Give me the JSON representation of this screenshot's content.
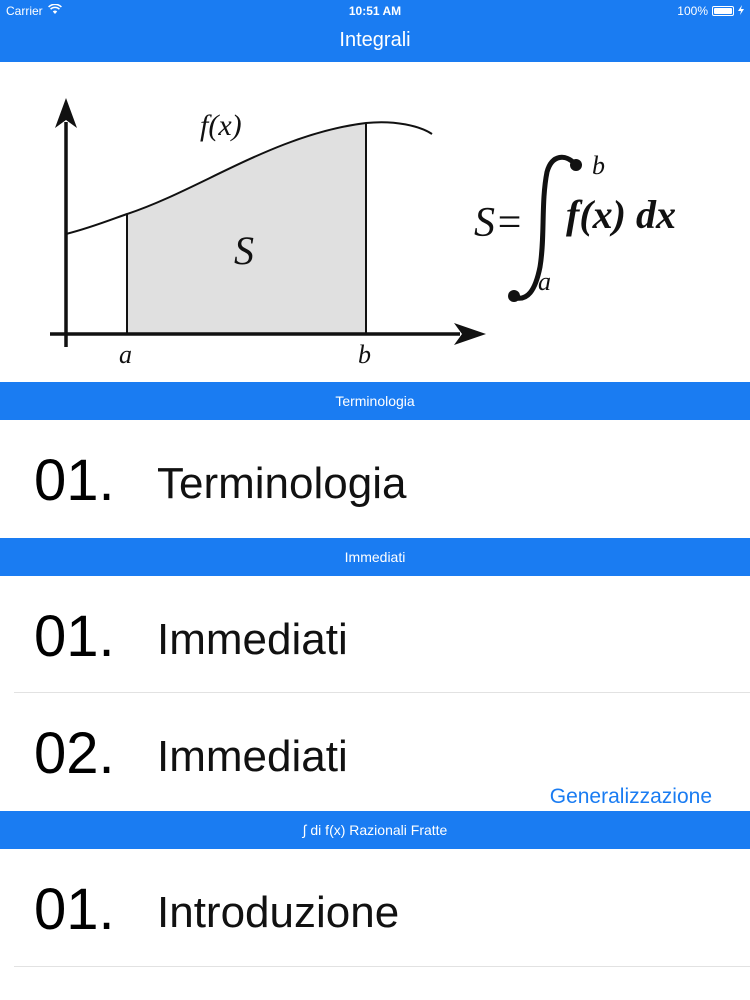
{
  "status_bar": {
    "carrier": "Carrier",
    "time": "10:51 AM",
    "battery": "100%",
    "battery_level": 1.0,
    "icons": [
      "wifi-icon",
      "battery-icon",
      "charging-icon"
    ]
  },
  "nav": {
    "title": "Integrali"
  },
  "hero": {
    "function_label": "f(x)",
    "area_label": "S",
    "lower_bound": "a",
    "upper_bound": "b",
    "formula": {
      "lhs": "S=",
      "integrand": "f(x) dx"
    }
  },
  "sections": [
    {
      "header": "Terminologia",
      "rows": [
        {
          "number": "01.",
          "title": "Terminologia",
          "subtitle": ""
        }
      ]
    },
    {
      "header": "Immediati",
      "rows": [
        {
          "number": "01.",
          "title": "Immediati",
          "subtitle": ""
        },
        {
          "number": "02.",
          "title": "Immediati",
          "subtitle": "Generalizzazione"
        }
      ]
    },
    {
      "header": "∫ di f(x) Razionali Fratte",
      "rows": [
        {
          "number": "01.",
          "title": "Introduzione",
          "subtitle": ""
        }
      ]
    }
  ],
  "colors": {
    "accent": "#1a7cf2",
    "background": "#ffffff",
    "text": "#000000",
    "separator": "#e2e2e2",
    "area_fill": "#e0e0e0"
  }
}
